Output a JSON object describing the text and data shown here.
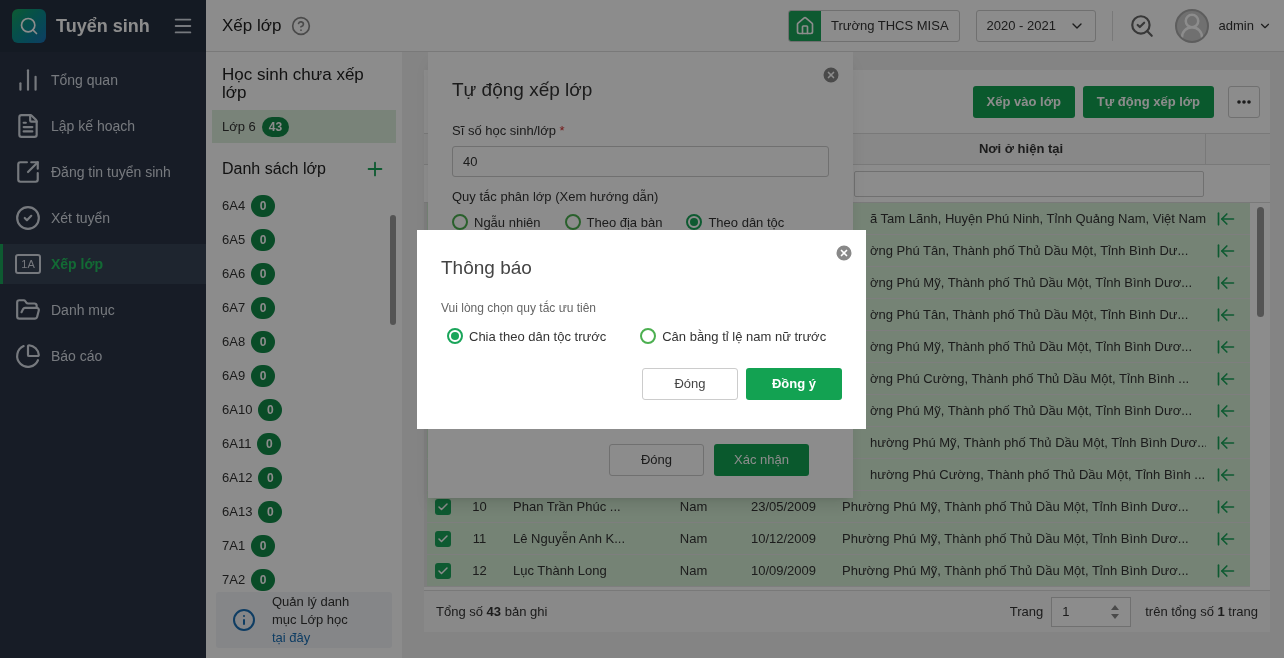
{
  "app": {
    "title": "Tuyển sinh"
  },
  "nav": [
    {
      "label": "Tổng quan",
      "kind": "overview",
      "selected": false
    },
    {
      "label": "Lập kế hoạch",
      "kind": "plan",
      "selected": false
    },
    {
      "label": "Đăng tin tuyển sinh",
      "kind": "post",
      "selected": false
    },
    {
      "label": "Xét tuyển",
      "kind": "review",
      "selected": false
    },
    {
      "label": "Xếp lớp",
      "kind": "classes",
      "icon_text": "1A",
      "selected": true
    },
    {
      "label": "Danh mục",
      "kind": "catalog",
      "selected": false
    },
    {
      "label": "Báo cáo",
      "kind": "report",
      "selected": false
    }
  ],
  "header": {
    "title": "Xếp lớp",
    "school": "Trường THCS MISA",
    "year": "2020 - 2021",
    "user": "admin"
  },
  "left_panel": {
    "unassigned_title": "Học sinh chưa xếp lớp",
    "unassigned": [
      {
        "label": "Lớp 6",
        "count": "43",
        "selected": true
      }
    ],
    "classes_title": "Danh sách lớp",
    "classes": [
      {
        "label": "6A4",
        "count": "0"
      },
      {
        "label": "6A5",
        "count": "0"
      },
      {
        "label": "6A6",
        "count": "0"
      },
      {
        "label": "6A7",
        "count": "0"
      },
      {
        "label": "6A8",
        "count": "0"
      },
      {
        "label": "6A9",
        "count": "0"
      },
      {
        "label": "6A10",
        "count": "0"
      },
      {
        "label": "6A11",
        "count": "0"
      },
      {
        "label": "6A12",
        "count": "0"
      },
      {
        "label": "6A13",
        "count": "0"
      },
      {
        "label": "7A1",
        "count": "0"
      },
      {
        "label": "7A2",
        "count": "0"
      }
    ],
    "info": {
      "text": "Quản lý danh mục Lớp học",
      "link": "tại đây"
    }
  },
  "toolbar": {
    "buttons": [
      "Xếp vào lớp",
      "Tự động xếp lớp"
    ]
  },
  "table": {
    "columns": [
      {
        "label": "Nơi ở hiện tại"
      }
    ],
    "rows": [
      {
        "kind": "covered",
        "selected": true,
        "address": "ã Tam Lãnh, Huyện Phú Ninh, Tỉnh Quảng Nam, Việt Nam"
      },
      {
        "kind": "covered",
        "selected": true,
        "address": "ờng Phú Tân, Thành phố Thủ Dầu Một, Tỉnh Bình Dư..."
      },
      {
        "kind": "covered",
        "selected": true,
        "address": "ờng Phú Mỹ, Thành phố Thủ Dầu Một, Tỉnh Bình Dươ..."
      },
      {
        "kind": "covered",
        "selected": true,
        "address": "ờng Phú Tân, Thành phố Thủ Dầu Một, Tỉnh Bình Dư..."
      },
      {
        "kind": "covered",
        "selected": true,
        "address": "ờng Phú Mỹ, Thành phố Thủ Dầu Một, Tỉnh Bình Dươ..."
      },
      {
        "kind": "covered",
        "selected": true,
        "address": "ờng Phú Cường, Thành phố Thủ Dầu Một, Tỉnh Bình ..."
      },
      {
        "kind": "covered",
        "selected": true,
        "address": "ờng Phú Mỹ, Thành phố Thủ Dầu Một, Tỉnh Bình Dươ..."
      },
      {
        "kind": "covered",
        "selected": true,
        "address": "hường Phú Mỹ, Thành phố Thủ Dầu Một, Tỉnh Bình Dươ..."
      },
      {
        "kind": "covered",
        "selected": true,
        "address": "hường Phú Cường, Thành phố Thủ Dầu Một, Tỉnh Bình ..."
      },
      {
        "kind": "full",
        "selected": true,
        "checked": true,
        "no": "10",
        "name": "Phan Trần Phúc ...",
        "gender": "Nam",
        "dob": "23/05/2009",
        "address": "Phường Phú Mỹ, Thành phố Thủ Dầu Một, Tỉnh Bình Dươ..."
      },
      {
        "kind": "full",
        "selected": true,
        "checked": true,
        "no": "11",
        "name": "Lê Nguyễn Anh K...",
        "gender": "Nam",
        "dob": "10/12/2009",
        "address": "Phường Phú Mỹ, Thành phố Thủ Dầu Một, Tỉnh Bình Dươ..."
      },
      {
        "kind": "full",
        "selected": true,
        "checked": true,
        "no": "12",
        "name": "Lục Thành Long",
        "gender": "Nam",
        "dob": "10/09/2009",
        "address": "Phường Phú Mỹ, Thành phố Thủ Dầu Một, Tỉnh Bình Dươ..."
      }
    ]
  },
  "footer": {
    "total": "Tổng số **43** bản ghi",
    "page_label": "Trang",
    "page": "1",
    "pages": "trên tổng số **1** trang"
  },
  "auto_dialog": {
    "title": "Tự động xếp lớp",
    "size_label": "Sĩ số học sinh/lớp",
    "required_mark": "*",
    "size_value": "40",
    "rule_label": "Quy tắc phân lớp (Xem hướng dẫn)",
    "rules": [
      {
        "label": "Ngẫu nhiên",
        "selected": false
      },
      {
        "label": "Theo địa bàn",
        "selected": false
      },
      {
        "label": "Theo dân tộc",
        "selected": true
      }
    ],
    "buttons": [
      "Đóng",
      "Xác nhận"
    ]
  },
  "notice_dialog": {
    "title": "Thông báo",
    "prompt": "Vui lòng chọn quy tắc ưu tiên",
    "options": [
      {
        "label": "Chia theo dân tộc trước",
        "selected": true
      },
      {
        "label": "Cân bằng tỉ lệ nam nữ trước",
        "selected": false
      }
    ],
    "buttons": [
      "Đóng",
      "Đồng ý"
    ]
  }
}
